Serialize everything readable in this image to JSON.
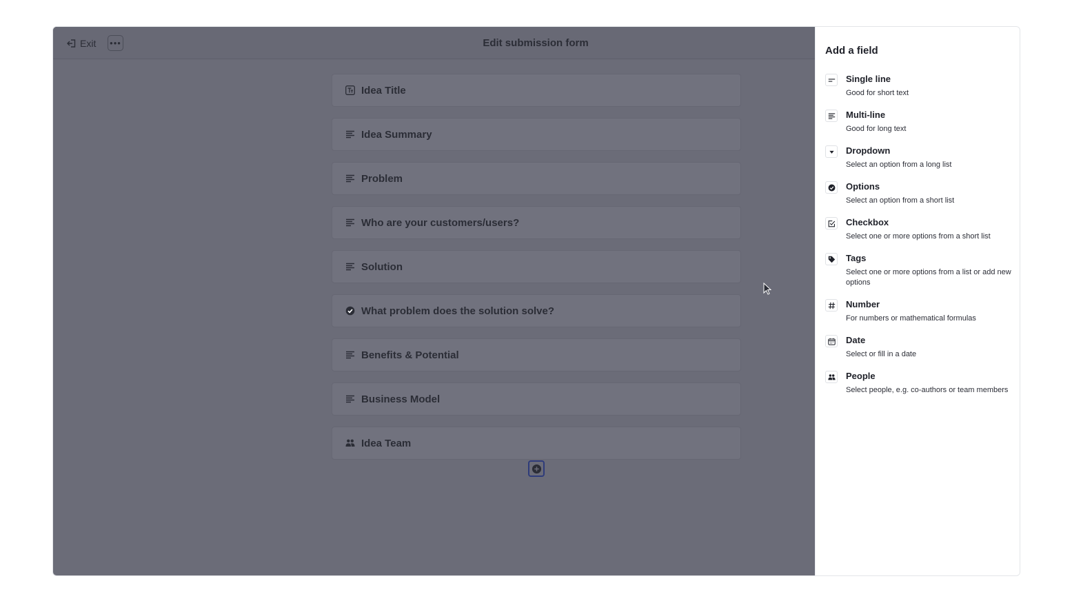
{
  "header": {
    "exit_label": "Exit",
    "more_label": "•••",
    "title": "Edit submission form"
  },
  "form_fields": [
    {
      "label": "Idea Title",
      "icon": "text-title-icon"
    },
    {
      "label": "Idea Summary",
      "icon": "multiline-icon"
    },
    {
      "label": "Problem",
      "icon": "multiline-icon"
    },
    {
      "label": "Who are your customers/users?",
      "icon": "multiline-icon"
    },
    {
      "label": "Solution",
      "icon": "multiline-icon"
    },
    {
      "label": "What problem does the solution solve?",
      "icon": "options-check-icon"
    },
    {
      "label": "Benefits & Potential",
      "icon": "multiline-icon"
    },
    {
      "label": "Business Model",
      "icon": "multiline-icon"
    },
    {
      "label": "Idea Team",
      "icon": "people-icon"
    }
  ],
  "panel": {
    "title": "Add a field",
    "field_types": [
      {
        "name": "Single line",
        "description": "Good for short text",
        "icon": "single-line-icon"
      },
      {
        "name": "Multi-line",
        "description": "Good for long text",
        "icon": "multiline-icon"
      },
      {
        "name": "Dropdown",
        "description": "Select an option from a long list",
        "icon": "dropdown-icon"
      },
      {
        "name": "Options",
        "description": "Select an option from a short list",
        "icon": "options-check-icon"
      },
      {
        "name": "Checkbox",
        "description": "Select one or more options from a short list",
        "icon": "checkbox-icon"
      },
      {
        "name": "Tags",
        "description": "Select one or more options from a list or add new options",
        "icon": "tag-icon"
      },
      {
        "name": "Number",
        "description": "For numbers or mathematical formulas",
        "icon": "hash-icon"
      },
      {
        "name": "Date",
        "description": "Select or fill in a date",
        "icon": "calendar-icon"
      },
      {
        "name": "People",
        "description": "Select people, e.g. co-authors or team members",
        "icon": "people-icon"
      }
    ]
  },
  "colors": {
    "overlay": "#6b6c78",
    "card": "#71727e",
    "text_dark": "#2b2d36",
    "add_button_border": "#2e3b7a"
  }
}
